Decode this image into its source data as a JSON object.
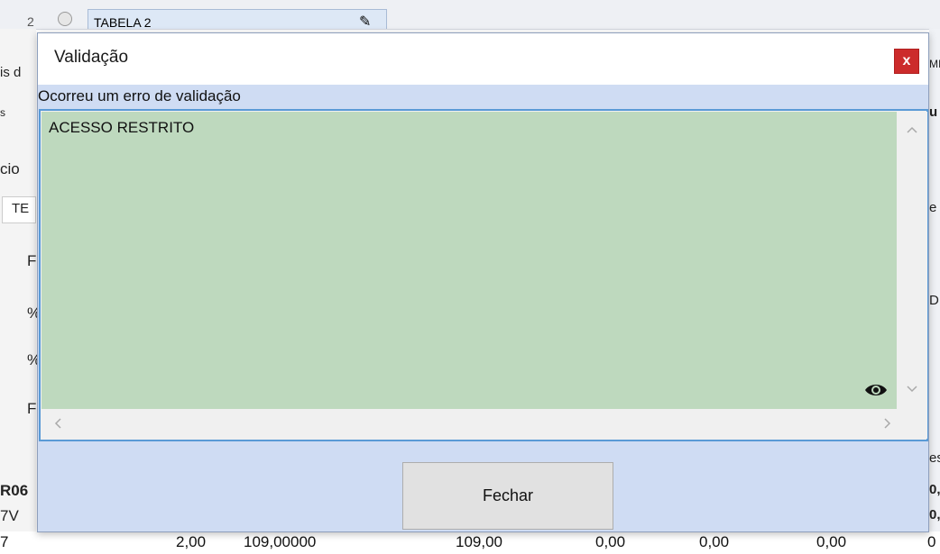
{
  "background": {
    "tab_number": "2",
    "tab_title": "TABELA 2",
    "left_fragments": [
      "is d",
      "s",
      "cio",
      "TE",
      "F",
      "%",
      "%",
      "F",
      "R06",
      "7V",
      "7"
    ],
    "right_fragments": [
      "MI",
      "u",
      "e",
      "D",
      "es",
      "0,",
      "0,",
      "0"
    ],
    "bottom_row": [
      "2,00",
      "109,00000",
      "109,00",
      "0,00",
      "0,00",
      "0,00"
    ]
  },
  "dialog": {
    "title": "Validação",
    "close_label": "x",
    "subtitle": "Ocorreu um erro de validação",
    "message": "ACESSO RESTRITO",
    "button_label": "Fechar"
  },
  "icons": {
    "close": "close-icon",
    "eye": "eye-icon",
    "scroll_up": "chevron-up-icon",
    "scroll_down": "chevron-down-icon",
    "scroll_left": "chevron-left-icon",
    "scroll_right": "chevron-right-icon"
  },
  "colors": {
    "dialog_background": "#cfdcf3",
    "message_background": "#bed9be",
    "close_button": "#cc2b2b",
    "focus_border": "#5a9ad6"
  }
}
